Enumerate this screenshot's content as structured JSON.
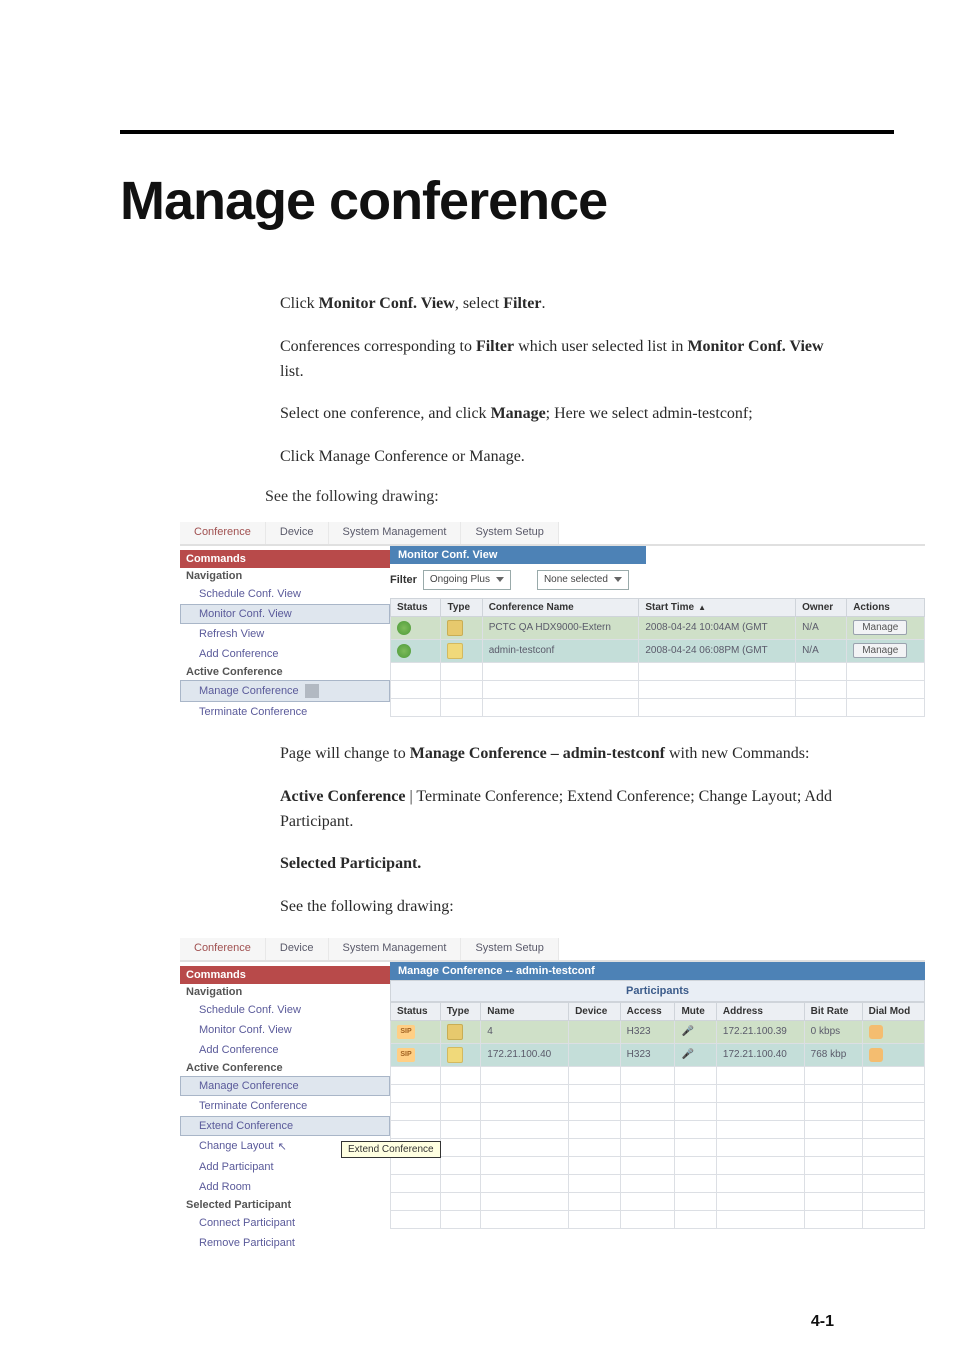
{
  "doc": {
    "title": "Manage conference",
    "step1_pre": "Click ",
    "step1_b1": "Monitor Conf. View",
    "step1_mid": ", select ",
    "step1_b2": "Filter",
    "step1_post": ".",
    "step2_pre": "Conferences corresponding to ",
    "step2_b1": "Filter",
    "step2_mid": " which user selected list in ",
    "step2_b2": "Monitor Conf. View",
    "step2_post": " list.",
    "step3_pre": "Select one conference, and click ",
    "step3_b1": "Manage",
    "step3_post": "; Here we select admin-testconf;",
    "step4": "Click Manage Conference or Manage.",
    "see1": "See the following drawing:",
    "after1a_pre": "Page will change to ",
    "after1a_b": "Manage Conference – admin-testconf",
    "after1a_post": " with new Commands:",
    "after1b_b": "Active Conference",
    "after1b_rest": " | Terminate Conference; Extend Conference; Change Layout; Add Participant.",
    "after1c": "Selected Participant.",
    "see2": "See the following drawing:",
    "footer": "4-1"
  },
  "tabs": {
    "conference": "Conference",
    "device": "Device",
    "sysmgmt": "System Management",
    "syssetup": "System Setup"
  },
  "shot1": {
    "title": "Monitor Conf. View",
    "sidebar": {
      "commands": "Commands",
      "navigation": "Navigation",
      "items": [
        "Schedule Conf. View",
        "Monitor Conf. View",
        "Refresh View",
        "Add Conference"
      ],
      "active_header": "Active Conference",
      "active_items": [
        "Manage Conference",
        "Terminate Conference"
      ]
    },
    "filter_label": "Filter",
    "filter_value": "Ongoing Plus",
    "filter_value2": "None selected",
    "table": {
      "headers": [
        "Status",
        "Type",
        "Conference Name",
        "Start Time",
        "Owner",
        "Actions"
      ],
      "rows": [
        {
          "name": "PCTC QA HDX9000-Extern",
          "start": "2008-04-24 10:04AM (GMT",
          "owner": "N/A",
          "action": "Manage"
        },
        {
          "name": "admin-testconf",
          "start": "2008-04-24 06:08PM (GMT",
          "owner": "N/A",
          "action": "Manage"
        }
      ]
    }
  },
  "shot2": {
    "title": "Manage Conference -- admin-testconf",
    "sidebar": {
      "commands": "Commands",
      "navigation": "Navigation",
      "nav_items": [
        "Schedule Conf. View",
        "Monitor Conf. View",
        "Add Conference"
      ],
      "active_header": "Active Conference",
      "active_items": [
        "Manage Conference",
        "Terminate Conference",
        "Extend Conference",
        "Change Layout",
        "Add Participant",
        "Add Room"
      ],
      "sel_header": "Selected Participant",
      "sel_items": [
        "Connect Participant",
        "Remove Participant"
      ],
      "tooltip": "Extend Conference"
    },
    "participants_label": "Participants",
    "table": {
      "headers": [
        "Status",
        "Type",
        "Name",
        "Device",
        "Access",
        "Mute",
        "Address",
        "Bit Rate",
        "Dial Mod"
      ],
      "rows": [
        {
          "name": "4",
          "access": "H323",
          "address": "172.21.100.39",
          "bitrate": "0 kbps",
          "dial": true
        },
        {
          "name": "172.21.100.40",
          "access": "H323",
          "address": "172.21.100.40",
          "bitrate": "768 kbp",
          "dial": true
        }
      ]
    }
  }
}
